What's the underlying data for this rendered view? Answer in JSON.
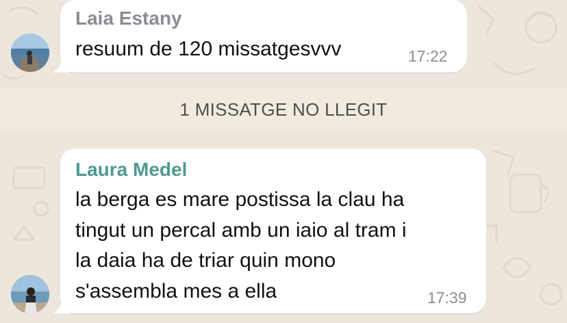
{
  "chat": {
    "messages": [
      {
        "sender": "Laia Estany",
        "sender_color": "#8f8a95",
        "text": "resuum de 120 missatgesvvv",
        "time": "17:22"
      },
      {
        "sender": "Laura Medel",
        "sender_color": "#4f9a8f",
        "text": "la berga es mare postissa la clau ha\ntingut un percal amb un iaio al tram i\nla daia ha de triar quin mono\ns'assembla mes a ella",
        "time": "17:39"
      }
    ],
    "unread_divider": "1 MISSATGE NO LLEGIT"
  },
  "colors": {
    "bubble_background": "#ffffff",
    "chat_background": "#ece6dd",
    "divider_background": "#f1ebdf"
  }
}
